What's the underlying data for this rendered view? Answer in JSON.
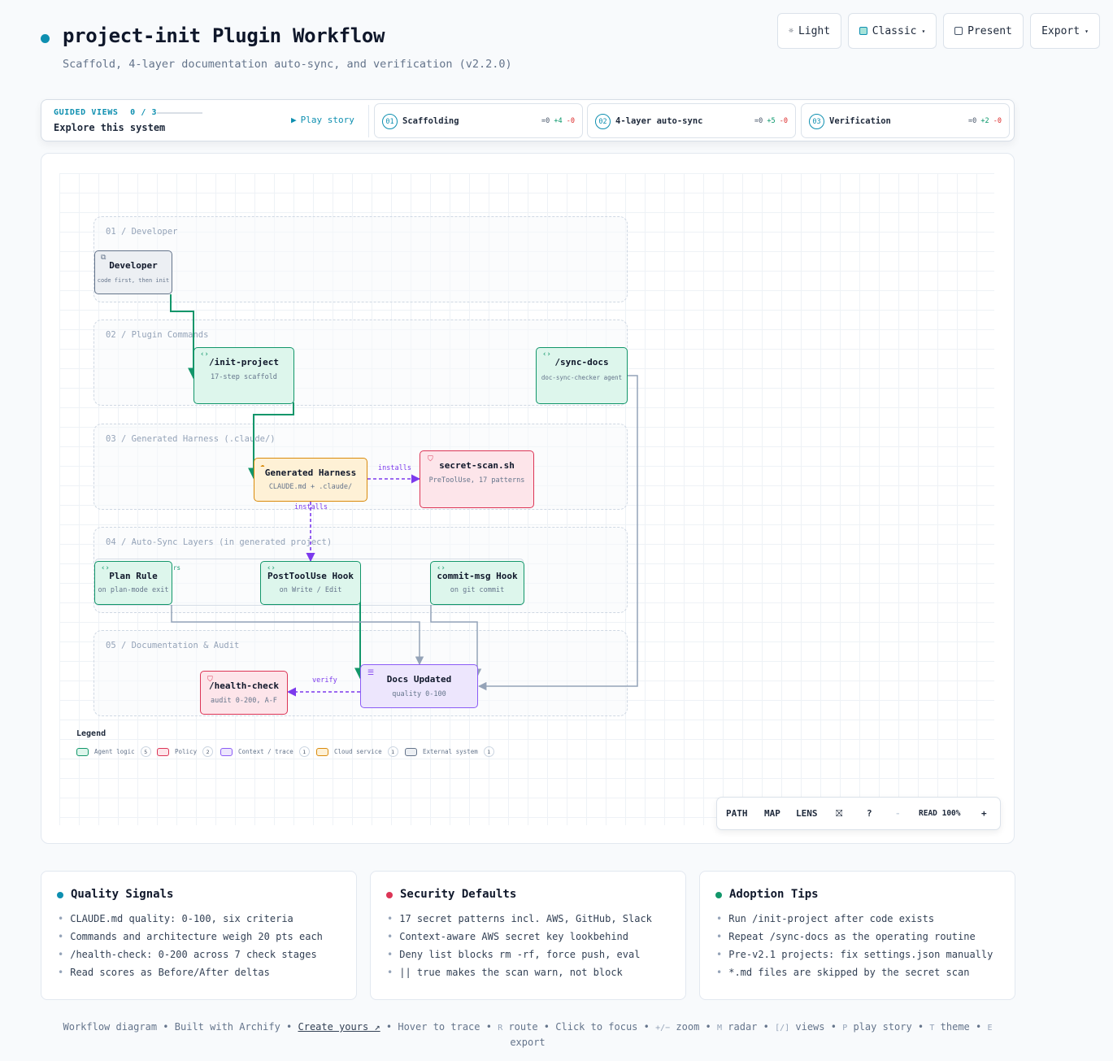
{
  "header": {
    "title": "project-init Plugin Workflow",
    "subtitle": "Scaffold, 4-layer documentation auto-sync, and verification (v2.2.0)"
  },
  "toolbar": {
    "light_label": "Light",
    "theme_label": "Classic",
    "present_label": "Present",
    "export_label": "Export"
  },
  "guided": {
    "kicker": "GUIDED VIEWS",
    "progress": "0 / 3",
    "title": "Explore this system",
    "play_label": "Play story",
    "views": [
      {
        "num": "01",
        "label": "Scaffolding",
        "same": "=0",
        "added": "+4",
        "removed": "-0"
      },
      {
        "num": "02",
        "label": "4-layer auto-sync",
        "same": "=0",
        "added": "+5",
        "removed": "-0"
      },
      {
        "num": "03",
        "label": "Verification",
        "same": "=0",
        "added": "+2",
        "removed": "-0"
      }
    ]
  },
  "lanes": [
    "01 / Developer",
    "02 / Plugin Commands",
    "03 / Generated Harness (.claude/)",
    "04 / Auto-Sync Layers (in generated project)",
    "05 / Documentation & Audit"
  ],
  "nodes": {
    "developer": {
      "title": "Developer",
      "sub": "code first, then init",
      "kind": "external"
    },
    "init_project": {
      "title": "/init-project",
      "sub": "17-step scaffold",
      "kind": "agent"
    },
    "sync_docs": {
      "title": "/sync-docs",
      "sub": "doc-sync-checker agent",
      "kind": "agent"
    },
    "harness": {
      "title": "Generated Harness",
      "sub": "CLAUDE.md + .claude/",
      "kind": "cloud"
    },
    "secret_scan": {
      "title": "secret-scan.sh",
      "sub": "PreToolUse, 17 patterns",
      "kind": "policy"
    },
    "plan_rule": {
      "title": "Plan Rule",
      "sub": "on plan-mode exit",
      "kind": "agent"
    },
    "posttooluse": {
      "title": "PostToolUse Hook",
      "sub": "on Write / Edit",
      "kind": "agent"
    },
    "commit_msg": {
      "title": "commit-msg Hook",
      "sub": "on git commit",
      "kind": "agent"
    },
    "docs_updated": {
      "title": "Docs Updated",
      "sub": "quality 0-100",
      "kind": "context"
    },
    "health_check": {
      "title": "/health-check",
      "sub": "audit 0-200, A-F",
      "kind": "policy"
    }
  },
  "edge_labels": {
    "installs_secret": "installs",
    "installs_layers": "installs",
    "verify": "verify",
    "triggers_fragment": "rs"
  },
  "legend": {
    "title": "Legend",
    "items": [
      {
        "label": "Agent logic",
        "count": "5",
        "border": "#12966a",
        "fill": "#ddf6ec"
      },
      {
        "label": "Policy",
        "count": "2",
        "border": "#dc3556",
        "fill": "#fde5ea"
      },
      {
        "label": "Context / trace",
        "count": "1",
        "border": "#8b5cf6",
        "fill": "#ede6fd"
      },
      {
        "label": "Cloud service",
        "count": "1",
        "border": "#d98a0b",
        "fill": "#fef1d6"
      },
      {
        "label": "External system",
        "count": "1",
        "border": "#64748b",
        "fill": "#eceff3"
      }
    ]
  },
  "controls": {
    "path": "PATH",
    "map": "MAP",
    "lens": "LENS",
    "help": "?",
    "zoom_out": "-",
    "read": "READ 100%",
    "zoom_in": "+"
  },
  "cards": [
    {
      "title": "Quality Signals",
      "dot": "#0e8fb0",
      "items": [
        "CLAUDE.md quality: 0-100, six criteria",
        "Commands and architecture weigh 20 pts each",
        "/health-check: 0-200 across 7 check stages",
        "Read scores as Before/After deltas"
      ]
    },
    {
      "title": "Security Defaults",
      "dot": "#dc3556",
      "items": [
        "17 secret patterns incl. AWS, GitHub, Slack",
        "Context-aware AWS secret key lookbehind",
        "Deny list blocks rm -rf, force push, eval",
        "|| true makes the scan warn, not block"
      ]
    },
    {
      "title": "Adoption Tips",
      "dot": "#12966a",
      "items": [
        "Run /init-project after code exists",
        "Repeat /sync-docs as the operating routine",
        "Pre-v2.1 projects: fix settings.json manually",
        "*.md files are skipped by the secret scan"
      ]
    }
  ],
  "footer": {
    "workflow": "Workflow diagram",
    "built": "Built with Archify",
    "create": "Create yours ↗",
    "hover": "Hover to trace",
    "route_key": "R",
    "route": "route",
    "click": "Click to focus",
    "zoom_key": "+/−",
    "zoom": "zoom",
    "radar_key": "M",
    "radar": "radar",
    "views_key": "[/]",
    "views": "views",
    "play_key": "P",
    "play": "play story",
    "theme_key": "T",
    "theme": "theme",
    "export_key": "E",
    "export": "export"
  }
}
